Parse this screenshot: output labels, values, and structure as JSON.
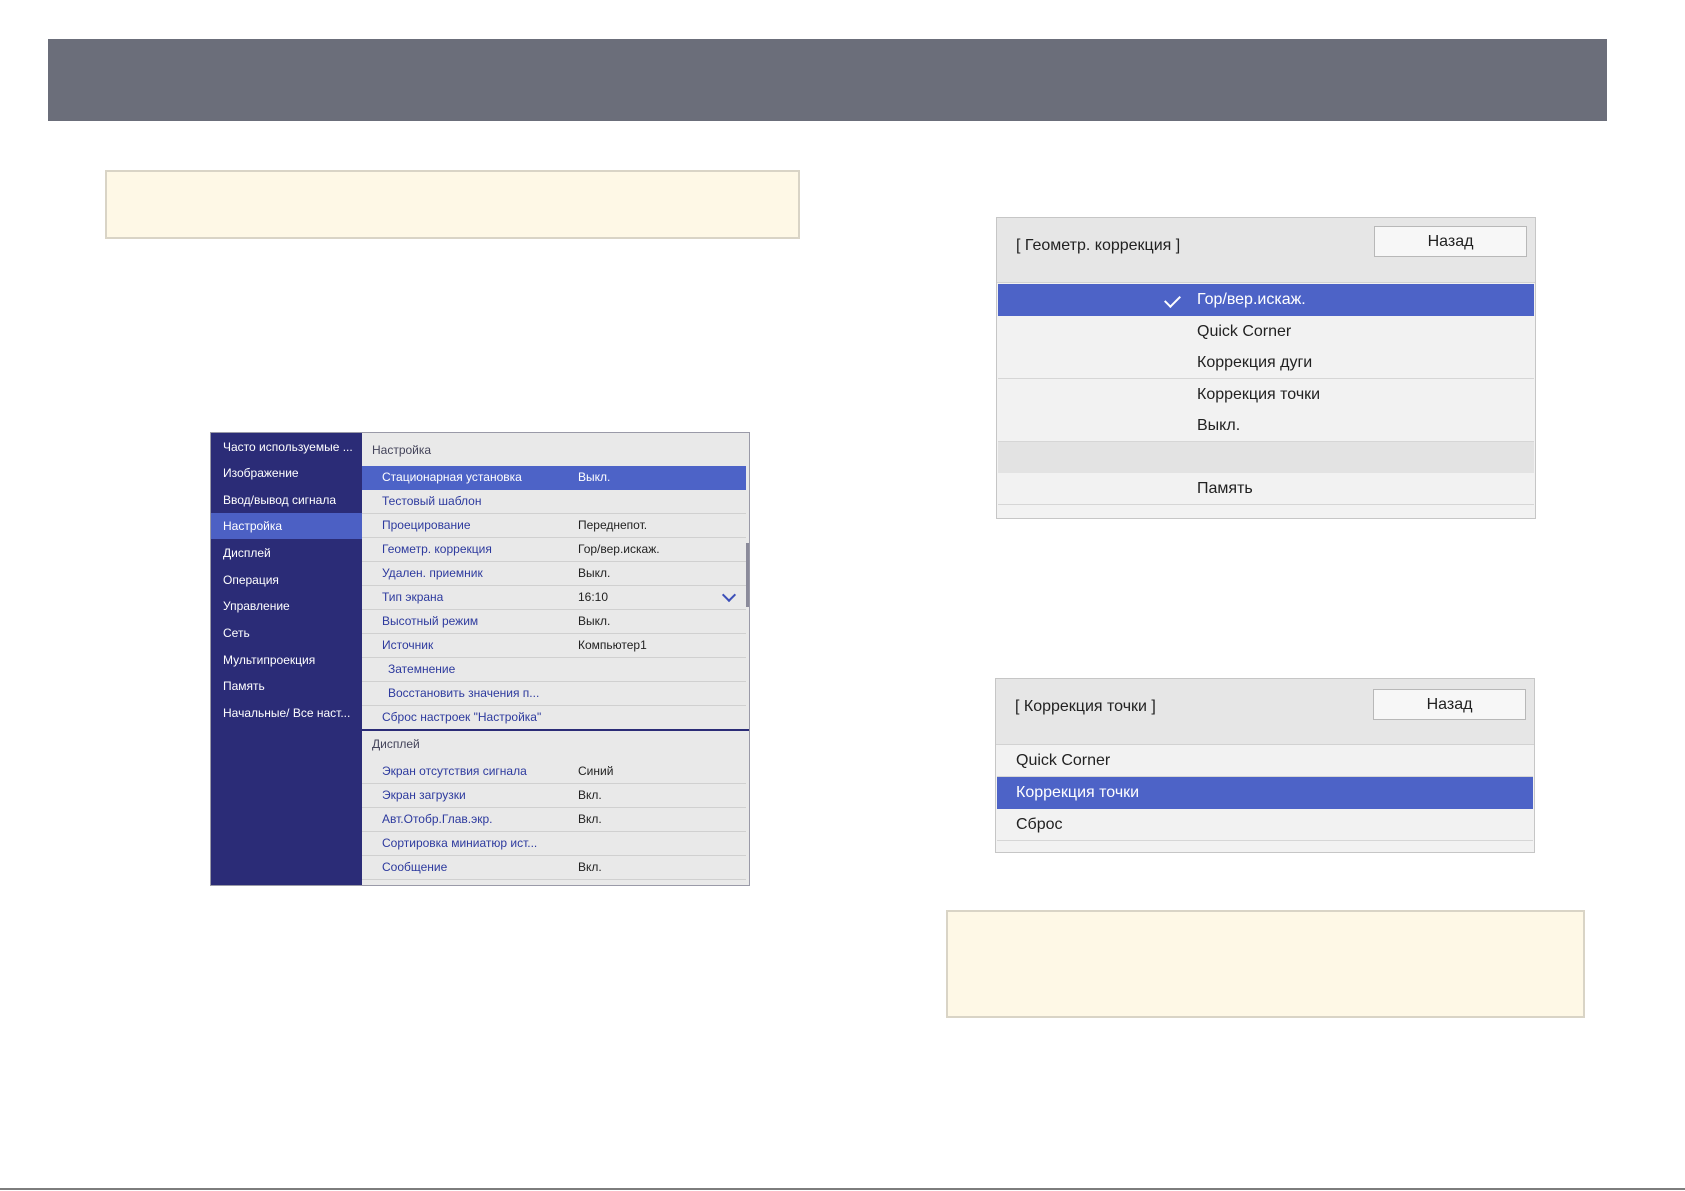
{
  "colors": {
    "header": "#6b6e7a",
    "menu_side": "#2b2c77",
    "accent": "#4d63c7",
    "note": "#fef8e6"
  },
  "settings_menu": {
    "sidebar": [
      "Часто используемые ...",
      "Изображение",
      "Ввод/вывод сигнала",
      "Настройка",
      "Дисплей",
      "Операция",
      "Управление",
      "Сеть",
      "Мультипроекция",
      "Память",
      "Начальные/ Все наст..."
    ],
    "active_sidebar_item": "Настройка",
    "section_setup": "Настройка",
    "setup_rows": [
      {
        "label": "Стационарная установка",
        "value": "Выкл."
      },
      {
        "label": "Тестовый шаблон",
        "value": ""
      },
      {
        "label": "Проецирование",
        "value": "Переднепот."
      },
      {
        "label": "Геометр. коррекция",
        "value": "Гор/вер.искаж."
      },
      {
        "label": "Удален. приемник",
        "value": "Выкл."
      },
      {
        "label": "Тип экрана",
        "value": "16:10"
      },
      {
        "label": "Высотный режим",
        "value": "Выкл."
      },
      {
        "label": "Источник",
        "value": "Компьютер1"
      },
      {
        "label": "Затемнение",
        "value": ""
      },
      {
        "label": "Восстановить значения п...",
        "value": ""
      },
      {
        "label": "Сброс настроек \"Настройка\"",
        "value": ""
      }
    ],
    "section_display": "Дисплей",
    "display_rows": [
      {
        "label": "Экран отсутствия сигнала",
        "value": "Синий"
      },
      {
        "label": "Экран загрузки",
        "value": "Вкл."
      },
      {
        "label": "Авт.Отобр.Глав.экр.",
        "value": "Вкл."
      },
      {
        "label": "Сортировка миниатюр ист...",
        "value": ""
      },
      {
        "label": "Сообщение",
        "value": "Вкл."
      }
    ]
  },
  "geometry_dialog": {
    "title": "[ Геометр. коррекция ]",
    "back": "Назад",
    "options": [
      "Гор/вер.искаж.",
      "Quick Corner",
      "Коррекция дуги",
      "Коррекция точки",
      "Выкл."
    ],
    "selected": "Гор/вер.искаж.",
    "memory": "Память"
  },
  "point_dialog": {
    "title": "[ Коррекция точки ]",
    "back": "Назад",
    "options": [
      "Quick Corner",
      "Коррекция точки",
      "Сброс"
    ],
    "selected": "Коррекция точки"
  }
}
